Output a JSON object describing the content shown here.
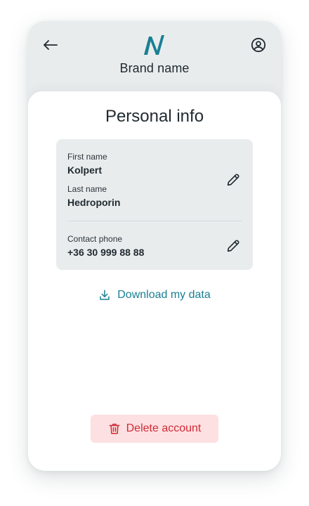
{
  "header": {
    "brand_name": "Brand name",
    "back_icon": "arrow-left-icon",
    "profile_icon": "user-circle-icon",
    "logo_icon": "brand-logo-n"
  },
  "page": {
    "title": "Personal info"
  },
  "personal_card": {
    "first_name_label": "First name",
    "first_name_value": "Kolpert",
    "last_name_label": "Last name",
    "last_name_value": "Hedroporin",
    "phone_label": "Contact phone",
    "phone_value": "+36 30 999 88 88",
    "edit_icon": "pencil-icon"
  },
  "actions": {
    "download_label": "Download my data",
    "download_icon": "download-icon",
    "delete_label": "Delete account",
    "delete_icon": "trash-icon"
  },
  "colors": {
    "accent": "#1a7f94",
    "danger": "#d12b38",
    "danger_bg": "#fde0e1",
    "surface": "#e9eced",
    "text": "#1f2a30"
  }
}
